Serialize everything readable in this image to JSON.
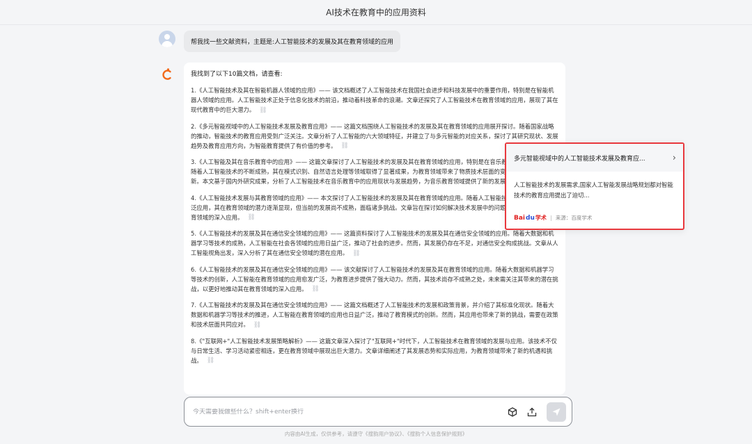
{
  "header": {
    "title": "AI技术在教育中的应用资料"
  },
  "user_message": "帮我找一些文献资料，主题是:人工智能技术的发展及其在教育领域的应用",
  "bot": {
    "intro": "我找到了以下10篇文档，请查看:",
    "items": [
      "1.《人工智能技术及其在智能机器人领域的应用》—— 该文档概述了人工智能技术在我国社会进步和科技发展中的重要作用，特别是在智能机器人领域的应用。人工智能技术正处于信息化技术的前沿，推动着科技革命的浪潮。文章还探究了人工智能技术在教育领域的应用，展现了其在现代教育中的巨大潜力。",
      "2.《多元智能视域中的人工智能技术发展及教育应用》—— 这篇文档围绕人工智能技术的发展及其在教育领域的应用展开探讨。随着国家战略的推动，智能技术的教育应用受到广泛关注。文章分析了人工智能的六大领域特征，并建立了与多元智能的对应关系，探讨了其研究现状、发展趋势及教育应用方向，为智能教育提供了有价值的参考。",
      "3.《人工智能及其在音乐教育中的应用》—— 这篇文章探讨了人工智能技术的发展及其在教育领域的应用，特别是在音乐教育中的创新应用。随着人工智能技术的不断成熟，其在模式识别、自然语言处理等领域取得了显著成果，为教育领域带来了物质技术层面的变革和教学模式的创新。本文基于国内外研究成果，分析了人工智能技术在音乐教育中的应用现状与发展趋势，为音乐教育领域提供了新的发展思路。",
      "4.《人工智能技术发展与其教育领域的应用》—— 本文探讨了人工智能技术的发展及其在教育领域的应用。随着人工智能技术的深入理解与广泛应用，其在教育领域的潜力逐渐显现，但当前的发展尚不成熟，面临诸多挑战。文章旨在探讨如何解决技术发展中的问题，推动人工智能在教育领域的深入应用。",
      "5.《人工智能技术的发展及其在通信安全领域的应用》—— 这篇资料探讨了人工智能技术的发展及其在通信安全领域的应用。随着大数据和机器学习等技术的成熟，人工智能在社会各领域的应用日益广泛，推动了社会的进步。然而，其发展仍存在不足，对通信安全构成挑战。文章从人工智能视角出发，深入分析了其在通信安全领域的潜在应用。",
      "6.《人工智能技术的发展及其在通信安全领域的应用》—— 该文献探讨了人工智能技术的发展及其在教育领域的应用。随着大数据和机器学习等技术的创新，人工智能在教育领域的应用愈发广泛，为教育进步提供了强大动力。然而，其技术尚存不成熟之处，未来需关注其带来的潜在挑战，以更好地推动其在教育领域的深入应用。",
      "7.《人工智能技术的发展及其在通信安全领域的应用》—— 这篇文档概述了人工智能技术的发展和政策背景，并介绍了其标准化现状。随着大数据和机器学习等技术的推进，人工智能在教育领域的应用也日益广泛，推动了教育模式的创新。然而，其应用也带来了新的挑战，需要在政策和技术层面共同应对。",
      "8.《\"互联网+\"人工智能技术发展策略解析》—— 这篇文章深入探讨了\"互联网+\"时代下，人工智能技术在教育领域的发展与应用。该技术不仅与日常生活、学习活动紧密相连，更在教育领域中展现出巨大潜力。文章详细阐述了其发展态势和实际应用，为教育领域带来了新的机遇和挑战。"
    ]
  },
  "popup": {
    "title": "多元智能视域中的人工智能技术发展及教育应...",
    "body": "人工智能技术的发展需求,国家人工智能发展战略规划都对智能技术的教育应用提出了迫切...",
    "logo_bai": "Bai",
    "logo_paw": "du",
    "logo_xs": "学术",
    "source": "来源：百度学术"
  },
  "input": {
    "placeholder": "今天需要我做些什么？shift+enter换行",
    "value": ""
  },
  "footer": "内容由AI生成，仅供参考，请遵守《搜韵用户协议》、《搜韵个人信息保护规则》"
}
